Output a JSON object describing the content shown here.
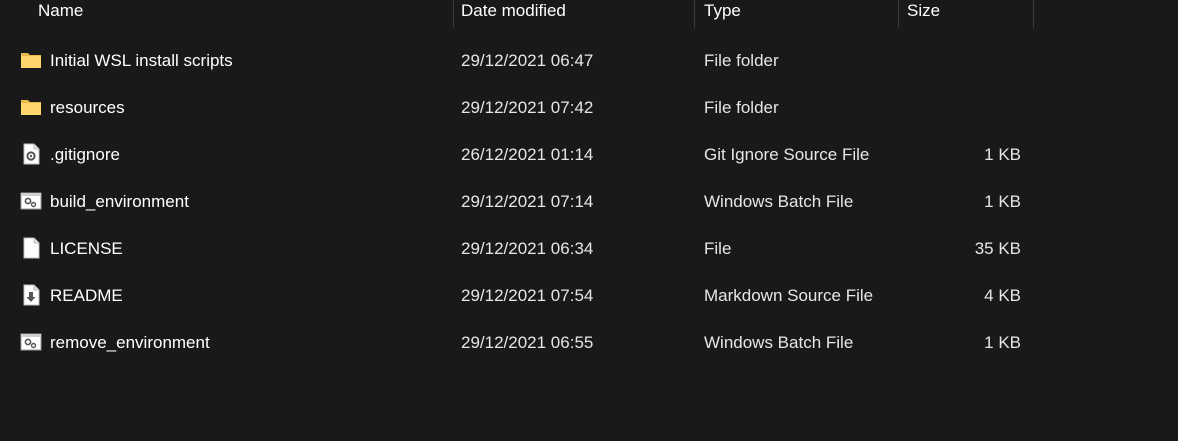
{
  "columns": {
    "name": "Name",
    "date": "Date modified",
    "type": "Type",
    "size": "Size"
  },
  "files": [
    {
      "icon": "folder-icon",
      "name": "Initial WSL install scripts",
      "date": "29/12/2021 06:47",
      "type": "File folder",
      "size": ""
    },
    {
      "icon": "folder-icon",
      "name": "resources",
      "date": "29/12/2021 07:42",
      "type": "File folder",
      "size": ""
    },
    {
      "icon": "gear-file-icon",
      "name": ".gitignore",
      "date": "26/12/2021 01:14",
      "type": "Git Ignore Source File",
      "size": "1 KB"
    },
    {
      "icon": "batch-file-icon",
      "name": "build_environment",
      "date": "29/12/2021 07:14",
      "type": "Windows Batch File",
      "size": "1 KB"
    },
    {
      "icon": "blank-file-icon",
      "name": "LICENSE",
      "date": "29/12/2021 06:34",
      "type": "File",
      "size": "35 KB"
    },
    {
      "icon": "markdown-file-icon",
      "name": "README",
      "date": "29/12/2021 07:54",
      "type": "Markdown Source File",
      "size": "4 KB"
    },
    {
      "icon": "batch-file-icon",
      "name": "remove_environment",
      "date": "29/12/2021 06:55",
      "type": "Windows Batch File",
      "size": "1 KB"
    }
  ]
}
